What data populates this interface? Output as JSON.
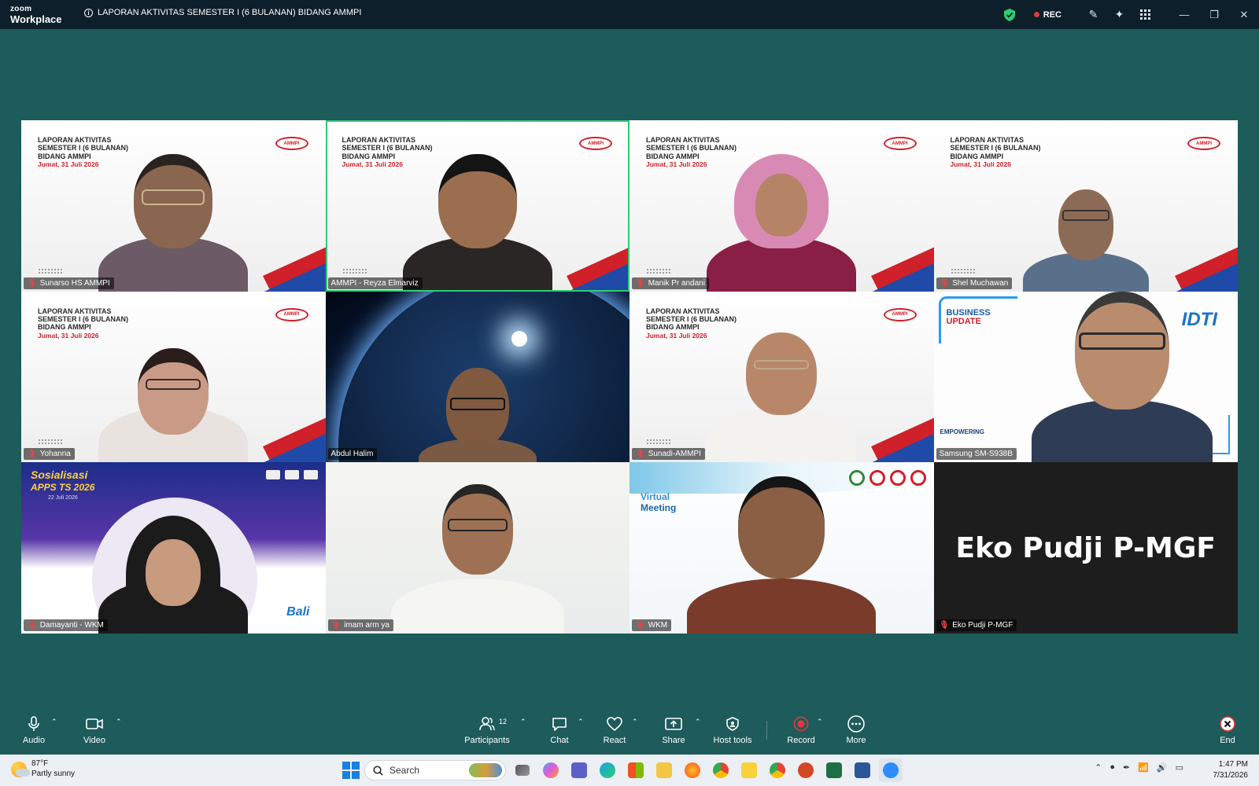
{
  "titlebar": {
    "brand_top": "zoom",
    "brand_bottom": "Workplace",
    "meeting_title": "LAPORAN AKTIVITAS SEMESTER I (6 BULANAN) BIDANG AMMPI",
    "rec_label": "REC",
    "security_color": "#2ecc71",
    "rec_color": "#e0383e"
  },
  "slide": {
    "line1": "LAPORAN AKTIVITAS",
    "line2": "SEMESTER I (6 BULANAN)",
    "line3": "BIDANG AMMPI",
    "date": "Jumat, 31 Juli 2026",
    "logo": "AMMPI"
  },
  "participants": [
    {
      "name": "Sunarso HS AMMPI",
      "muted": true,
      "background": "slide",
      "active": false
    },
    {
      "name": "AMMPI - Reyza Elmarviz",
      "muted": false,
      "background": "slide",
      "active": true
    },
    {
      "name": "Manik Pr andani",
      "muted": true,
      "background": "slide",
      "active": false
    },
    {
      "name": "Shel Muchawan",
      "muted": true,
      "background": "slide",
      "active": false
    },
    {
      "name": "Yohanna",
      "muted": true,
      "background": "slide",
      "active": false
    },
    {
      "name": "Abdul Halim",
      "muted": false,
      "background": "space",
      "active": false
    },
    {
      "name": "Sunadi-AMMPI",
      "muted": true,
      "background": "slide",
      "active": false
    },
    {
      "name": "Samsung SM-S938B",
      "muted": false,
      "background": "idti",
      "active": false
    },
    {
      "name": "Damayanti - WKM",
      "muted": true,
      "background": "bali",
      "active": false
    },
    {
      "name": "imam arm ya",
      "muted": true,
      "background": "plain",
      "active": false
    },
    {
      "name": "WKM",
      "muted": true,
      "background": "virtual-meeting",
      "active": false
    },
    {
      "name": "Eko Pudji P-MGF",
      "muted": true,
      "background": "video-off",
      "active": false
    }
  ],
  "idti": {
    "biz_line1": "BUSINESS",
    "biz_line2": "UPDATE",
    "logo": "IDTI",
    "bottom_text": "EMPOWERING"
  },
  "bali": {
    "title": "Sosialisasi",
    "subtitle": "APPS TS 2026",
    "date": "22 Juli 2026",
    "word": "Bali"
  },
  "virtual": {
    "line1": "Virtual",
    "line2": "Meeting"
  },
  "video_off_name": "Eko Pudji P-MGF",
  "toolbar": {
    "audio": "Audio",
    "video": "Video",
    "participants": "Participants",
    "participants_count": "12",
    "chat": "Chat",
    "react": "React",
    "share": "Share",
    "host_tools": "Host tools",
    "record": "Record",
    "more": "More",
    "end": "End"
  },
  "taskbar": {
    "temp": "87°F",
    "condition": "Partly sunny",
    "search_label": "Search",
    "time": "1:47 PM",
    "date": "7/31/2026"
  }
}
